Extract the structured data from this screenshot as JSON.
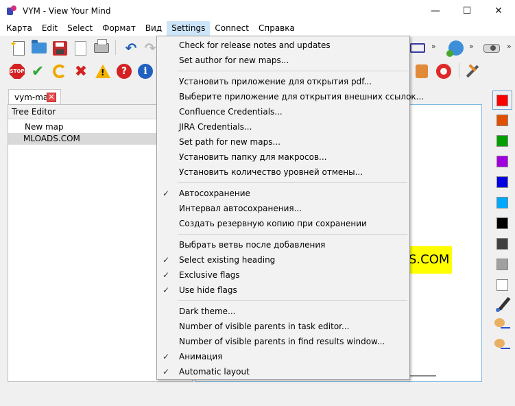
{
  "window": {
    "title": "VYM - View Your Mind",
    "controls": {
      "minimize": "—",
      "maximize": "☐",
      "close": "✕"
    }
  },
  "menubar": {
    "items": [
      "Карта",
      "Edit",
      "Select",
      "Формат",
      "Вид",
      "Settings",
      "Connect",
      "Справка"
    ],
    "active": "Settings"
  },
  "toolbar": {
    "chevron": "»",
    "row1_icons": [
      "new-map-icon",
      "open-folder-icon",
      "save-icon",
      "export-icon",
      "print-icon",
      "undo-icon",
      "redo-icon",
      "network-icon",
      "globe-icon",
      "projector-icon"
    ],
    "row2_icons": [
      "stop-icon",
      "check-icon",
      "refresh-icon",
      "cross-icon",
      "warning-icon",
      "question-icon",
      "info-icon",
      "thumb-down-icon",
      "lifebuoy-icon",
      "tools-icon"
    ],
    "stop_text": "STOP",
    "warn_text": "!",
    "question_text": "?",
    "info_text": "i"
  },
  "tab": {
    "label": "vym-map",
    "close": "✕"
  },
  "tree_editor": {
    "header": "Tree Editor",
    "rows": [
      "New map",
      "MLOADS.COM"
    ]
  },
  "map_view": {
    "node_text_visible": "S.COM"
  },
  "palette": {
    "colors": [
      "#ff0000",
      "#e05000",
      "#00a000",
      "#a000e0",
      "#0000e0",
      "#00a8ff",
      "#000000",
      "#404040",
      "#a0a0a0",
      "#ffffff"
    ],
    "tools": [
      "pipette-icon",
      "paint-text-icon",
      "paint-branch-icon"
    ]
  },
  "settings_menu": {
    "check_mark": "✓",
    "groups": [
      [
        {
          "label": "Check for release notes and updates",
          "checked": false
        },
        {
          "label": "Set author for new maps...",
          "checked": false
        }
      ],
      [
        {
          "label": "Установить приложение для открытия pdf...",
          "checked": false
        },
        {
          "label": "Выберите приложение для открытия внешних ссылок...",
          "checked": false
        },
        {
          "label": "Confluence Credentials...",
          "checked": false
        },
        {
          "label": "JIRA Credentials...",
          "checked": false
        },
        {
          "label": "Set path for new maps...",
          "checked": false
        },
        {
          "label": "Установить папку для макросов...",
          "checked": false
        },
        {
          "label": "Установить количество уровней отмены...",
          "checked": false
        }
      ],
      [
        {
          "label": "Автосохранение",
          "checked": true
        },
        {
          "label": "Интервал автосохранения...",
          "checked": false
        },
        {
          "label": "Создать резервную копию при сохранении",
          "checked": false
        }
      ],
      [
        {
          "label": "Выбрать ветвь после добавления",
          "checked": false
        },
        {
          "label": "Select existing heading",
          "checked": true
        },
        {
          "label": "Exclusive flags",
          "checked": true
        },
        {
          "label": "Use hide flags",
          "checked": true
        }
      ],
      [
        {
          "label": "Dark theme...",
          "checked": false
        },
        {
          "label": "Number of visible parents in task editor...",
          "checked": false
        },
        {
          "label": "Number of visible parents in find results window...",
          "checked": false
        },
        {
          "label": "Анимация",
          "checked": true
        },
        {
          "label": "Automatic layout",
          "checked": true
        }
      ]
    ]
  }
}
